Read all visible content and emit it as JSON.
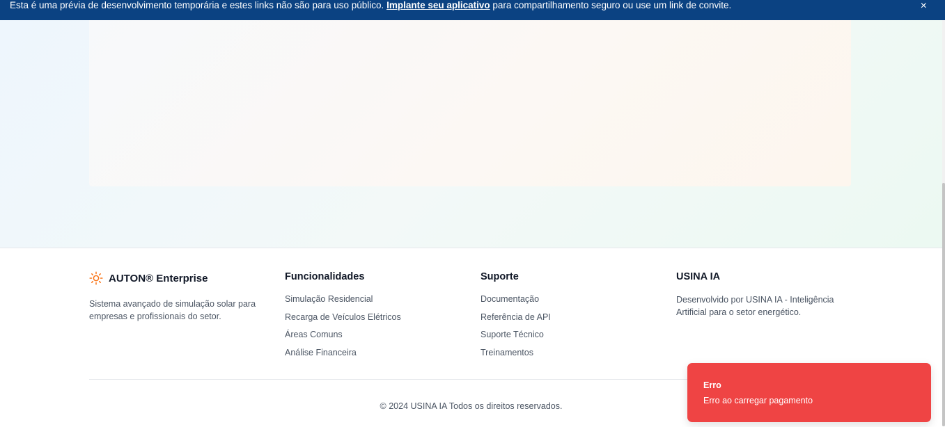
{
  "banner": {
    "text_before": "Esta é uma prévia de desenvolvimento temporária e estes links não são para uso público. ",
    "link": "Implante seu aplicativo",
    "text_after": " para compartilhamento seguro ou use um link de convite.",
    "close": "×",
    "bg_color": "#0b4282"
  },
  "footer": {
    "brand": {
      "icon": "sun-icon",
      "name": "AUTON® Enterprise",
      "description": "Sistema avançado de simulação solar para empresas e profissionais do setor."
    },
    "features": {
      "heading": "Funcionalidades",
      "items": [
        "Simulação Residencial",
        "Recarga de Veículos Elétricos",
        "Áreas Comuns",
        "Análise Financeira"
      ]
    },
    "support": {
      "heading": "Suporte",
      "items": [
        "Documentação",
        "Referência de API",
        "Suporte Técnico",
        "Treinamentos"
      ]
    },
    "usina": {
      "heading": "USINA IA",
      "description": "Desenvolvido por USINA IA - Inteligência Artificial para o setor energético."
    },
    "copyright": "© 2024 USINA IA Todos os direitos reservados."
  },
  "toast": {
    "title": "Erro",
    "message": "Erro ao carregar pagamento",
    "bg_color": "#ef4444"
  }
}
